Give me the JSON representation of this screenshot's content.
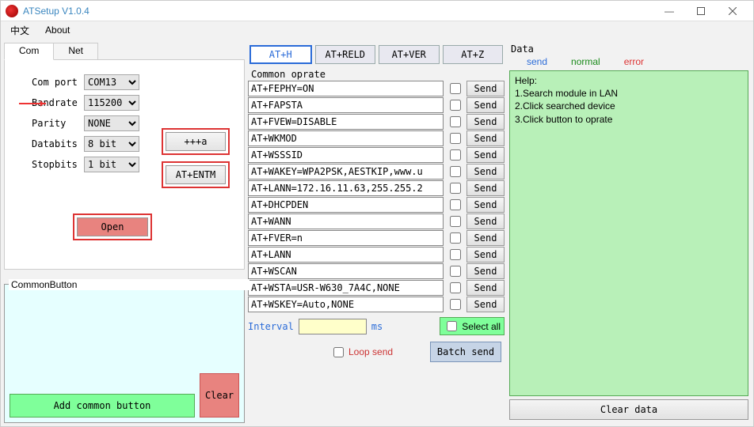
{
  "title": "ATSetup V1.0.4",
  "menu": {
    "cn": "中文",
    "about": "About"
  },
  "tabs": {
    "com": "Com",
    "net": "Net"
  },
  "form": {
    "comport_l": "Com port",
    "comport_v": "COM13",
    "baud_l": "Bandrate",
    "baud_v": "115200",
    "parity_l": "Parity",
    "parity_v": "NONE",
    "databits_l": "Databits",
    "databits_v": "8 bit",
    "stopbits_l": "Stopbits",
    "stopbits_v": "1 bit"
  },
  "btn_pppa": "+++a",
  "btn_entm": "AT+ENTM",
  "btn_open": "Open",
  "common_title": "CommonButton",
  "btn_addcommon": "Add common button",
  "btn_clear": "Clear",
  "at_top": [
    "AT+H",
    "AT+RELD",
    "AT+VER",
    "AT+Z"
  ],
  "common_oprate": "Common oprate",
  "ops": [
    "AT+FEPHY=ON",
    "AT+FAPSTA",
    "AT+FVEW=DISABLE",
    "AT+WKMOD",
    "AT+WSSSID",
    "AT+WAKEY=WPA2PSK,AESTKIP,www.u",
    "AT+LANN=172.16.11.63,255.255.2",
    "AT+DHCPDEN",
    "AT+WANN",
    "AT+FVER=n",
    "AT+LANN",
    "AT+WSCAN",
    "AT+WSTA=USR-W630_7A4C,NONE",
    "AT+WSKEY=Auto,NONE"
  ],
  "send_label": "Send",
  "interval_l": "Interval",
  "ms": "ms",
  "selectall": "Select all",
  "loop": "Loop send",
  "batch": "Batch send",
  "data_l": "Data",
  "legend": {
    "send": "send",
    "normal": "normal",
    "error": "error"
  },
  "help": {
    "t": "Help:",
    "l1": "1.Search module in LAN",
    "l2": "2.Click searched device",
    "l3": "3.Click button to oprate"
  },
  "cleardata": "Clear data"
}
